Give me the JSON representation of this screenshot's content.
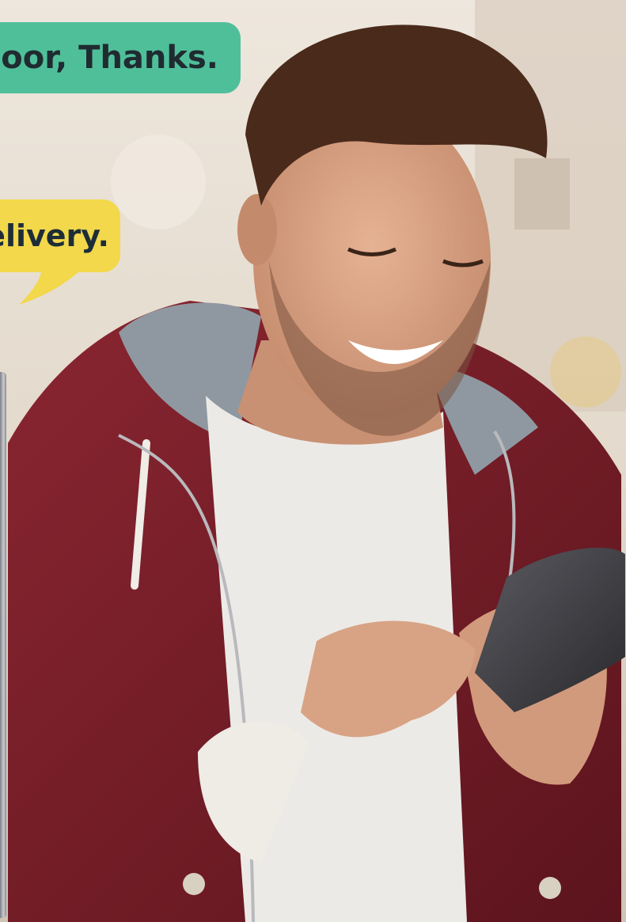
{
  "scene": {
    "description_free": true,
    "colors": {
      "background_top": "#e9e2d8",
      "background_bottom": "#d9cfc3",
      "jacket": "#7a1f2a",
      "jacket_shadow": "#4e1018",
      "hood_lining": "#8f98a0",
      "tshirt": "#eceae6",
      "skin": "#d9a386",
      "hair": "#4a2a1a",
      "phone": "#3a3a3e"
    }
  },
  "bubbles": {
    "green": {
      "text": "door, Thanks.",
      "color": "#4fbf9a"
    },
    "yellow": {
      "text": "elivery.",
      "color": "#f2d84a"
    }
  },
  "icons": {
    "bubble_tail": "speech-tail-icon"
  }
}
